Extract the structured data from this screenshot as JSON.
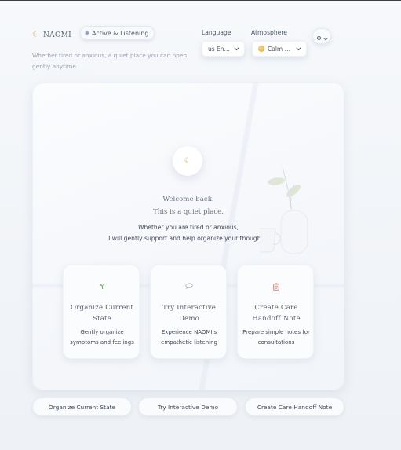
{
  "header": {
    "brand": "NAOMI",
    "status": "Active & Listening",
    "subtitle": "Whether tired or anxious, a quiet place you can open gently anytime"
  },
  "controls": {
    "language_label": "Language",
    "language_value": "us En…",
    "atmosphere_label": "Atmosphere",
    "atmosphere_value": "Calm …"
  },
  "hero": {
    "welcome_line1": "Welcome back.",
    "welcome_line2": "This is a quiet place.",
    "lead_line1": "Whether you are tired or anxious,",
    "lead_line2": "I will gently support and help organize your thoughts."
  },
  "cards": [
    {
      "title": "Organize Current State",
      "desc": "Gently organize symptoms and feelings",
      "icon": "sprout-icon"
    },
    {
      "title": "Try Interactive Demo",
      "desc": "Experience NAOMI's empathetic listening",
      "icon": "speech-bubble-icon"
    },
    {
      "title": "Create Care Handoff Note",
      "desc": "Prepare simple notes for consultations",
      "icon": "clipboard-icon"
    }
  ],
  "actions": {
    "organize": "Organize Current State",
    "demo": "Try Interactive Demo",
    "handoff": "Create Care Handoff Note"
  },
  "colors": {
    "accent_moon": "#e0b24a",
    "status_dot": "#8fa3c7",
    "background": "#f3f6f9"
  }
}
